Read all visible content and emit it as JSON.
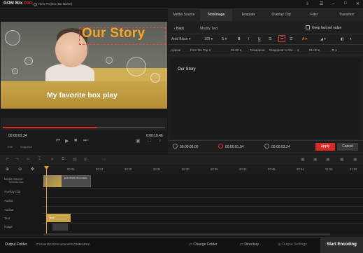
{
  "app": {
    "logo": "GOM Mix",
    "edition": "PRO",
    "project_title": "New Project (No Name)"
  },
  "tabs": [
    "Media Source",
    "Text/Image",
    "Template",
    "Overlay Clip",
    "Filter",
    "Transition"
  ],
  "text_panel": {
    "back": "Back",
    "title": "Modify Text",
    "keep_last": "Keep last set value",
    "font": "Arial Black",
    "size": "100",
    "style": "S",
    "bold": "B",
    "italic": "I",
    "underline": "U",
    "appear_label": "Appear",
    "appear_value": "from the Top",
    "appear_time": "01.00",
    "disappear_label": "Disappear",
    "disappear_value": "Disappear to the ...",
    "disappear_time": "01.00",
    "editor_text": "Our Story"
  },
  "durations": {
    "start": "00:00:00.00",
    "length": "00:00:01.04",
    "end": "00:00:03.24"
  },
  "buttons": {
    "apply": "Apply",
    "cancel": "Cancel"
  },
  "preview": {
    "overlay_title": "Our Story",
    "caption": "My favorite box play",
    "timecode": "00:00:01.34",
    "total": "0:00:10.46",
    "left_lbl": "Edit",
    "right_lbl": "Snapshot"
  },
  "ruler": [
    "00:05",
    "00:12",
    "00:18",
    "00:24",
    "00:30",
    "00:36",
    "00:42",
    "00:48",
    "00:54",
    "01:00",
    "01:06"
  ],
  "tracks": [
    "Media Source",
    "Overlay Clip",
    "Audio1",
    "Audio2",
    "Text",
    "Image"
  ],
  "clips": {
    "media_name": "previews.mov.wav",
    "media_lbl": "Yukimiko.wav",
    "text": "Text"
  },
  "bottom": {
    "output_folder": "Output Folder",
    "path": "C:\\Users\\GJ\\Documents\\GOMMixPro\\",
    "change_folder": "Change Folder",
    "directory": "Directory",
    "output_settings": "Output Settings",
    "start": "Start Encoding"
  }
}
